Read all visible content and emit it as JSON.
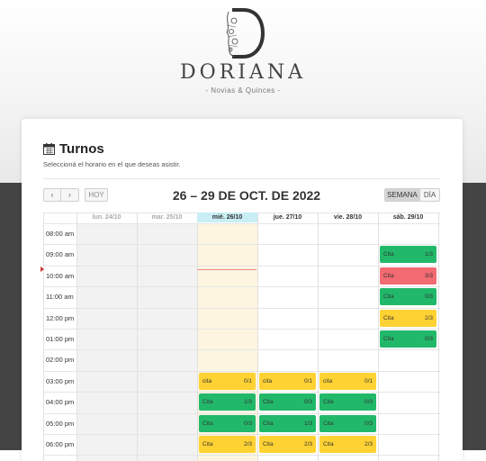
{
  "brand": {
    "name": "DORIANA",
    "subtitle": "- Novias & Quinces -"
  },
  "card": {
    "title": "Turnos",
    "subtitle": "Seleccioná el horario en el que deseas asistir."
  },
  "toolbar": {
    "prev_label": "‹",
    "next_label": "›",
    "today_label": "HOY",
    "range_title": "26 – 29 DE OCT. DE 2022",
    "week_label": "SEMANA",
    "day_label": "DÍA"
  },
  "days": [
    {
      "label": "lun. 24/10",
      "state": "past"
    },
    {
      "label": "mar. 25/10",
      "state": "past"
    },
    {
      "label": "mié. 26/10",
      "state": "today"
    },
    {
      "label": "jue. 27/10",
      "state": "normal"
    },
    {
      "label": "vie. 28/10",
      "state": "normal"
    },
    {
      "label": "sáb. 29/10",
      "state": "normal"
    }
  ],
  "times": [
    "08:00 am",
    "09:00 am",
    "10:00 am",
    "11:00 am",
    "12:00 pm",
    "01:00 pm",
    "02:00 pm",
    "03:00 pm",
    "04:00 pm",
    "05:00 pm",
    "06:00 pm"
  ],
  "events": [
    {
      "day": 5,
      "slot": 1,
      "name": "Cita",
      "count": "1/3",
      "color": "green"
    },
    {
      "day": 5,
      "slot": 2,
      "name": "Cita",
      "count": "3/3",
      "color": "red"
    },
    {
      "day": 5,
      "slot": 3,
      "name": "Cita",
      "count": "0/3",
      "color": "green"
    },
    {
      "day": 5,
      "slot": 4,
      "name": "Cita",
      "count": "2/3",
      "color": "yellow"
    },
    {
      "day": 5,
      "slot": 5,
      "name": "Cita",
      "count": "0/3",
      "color": "green"
    },
    {
      "day": 2,
      "slot": 7,
      "name": "cita",
      "count": "0/1",
      "color": "yellow"
    },
    {
      "day": 3,
      "slot": 7,
      "name": "cita",
      "count": "0/1",
      "color": "yellow"
    },
    {
      "day": 4,
      "slot": 7,
      "name": "cita",
      "count": "0/1",
      "color": "yellow"
    },
    {
      "day": 2,
      "slot": 8,
      "name": "Cita",
      "count": "1/3",
      "color": "green"
    },
    {
      "day": 3,
      "slot": 8,
      "name": "Cita",
      "count": "0/3",
      "color": "green"
    },
    {
      "day": 4,
      "slot": 8,
      "name": "Cita",
      "count": "0/3",
      "color": "green"
    },
    {
      "day": 2,
      "slot": 9,
      "name": "Cita",
      "count": "0/3",
      "color": "green"
    },
    {
      "day": 3,
      "slot": 9,
      "name": "Cita",
      "count": "1/3",
      "color": "green"
    },
    {
      "day": 4,
      "slot": 9,
      "name": "Cita",
      "count": "0/3",
      "color": "green"
    },
    {
      "day": 2,
      "slot": 10,
      "name": "Cita",
      "count": "2/3",
      "color": "yellow"
    },
    {
      "day": 3,
      "slot": 10,
      "name": "Cita",
      "count": "2/3",
      "color": "yellow"
    },
    {
      "day": 4,
      "slot": 10,
      "name": "Cita",
      "count": "2/3",
      "color": "yellow"
    }
  ],
  "icons": {
    "logo": "doriana-monogram-logo",
    "calendar": "calendar-icon",
    "prev": "chevron-left-icon",
    "next": "chevron-right-icon"
  }
}
